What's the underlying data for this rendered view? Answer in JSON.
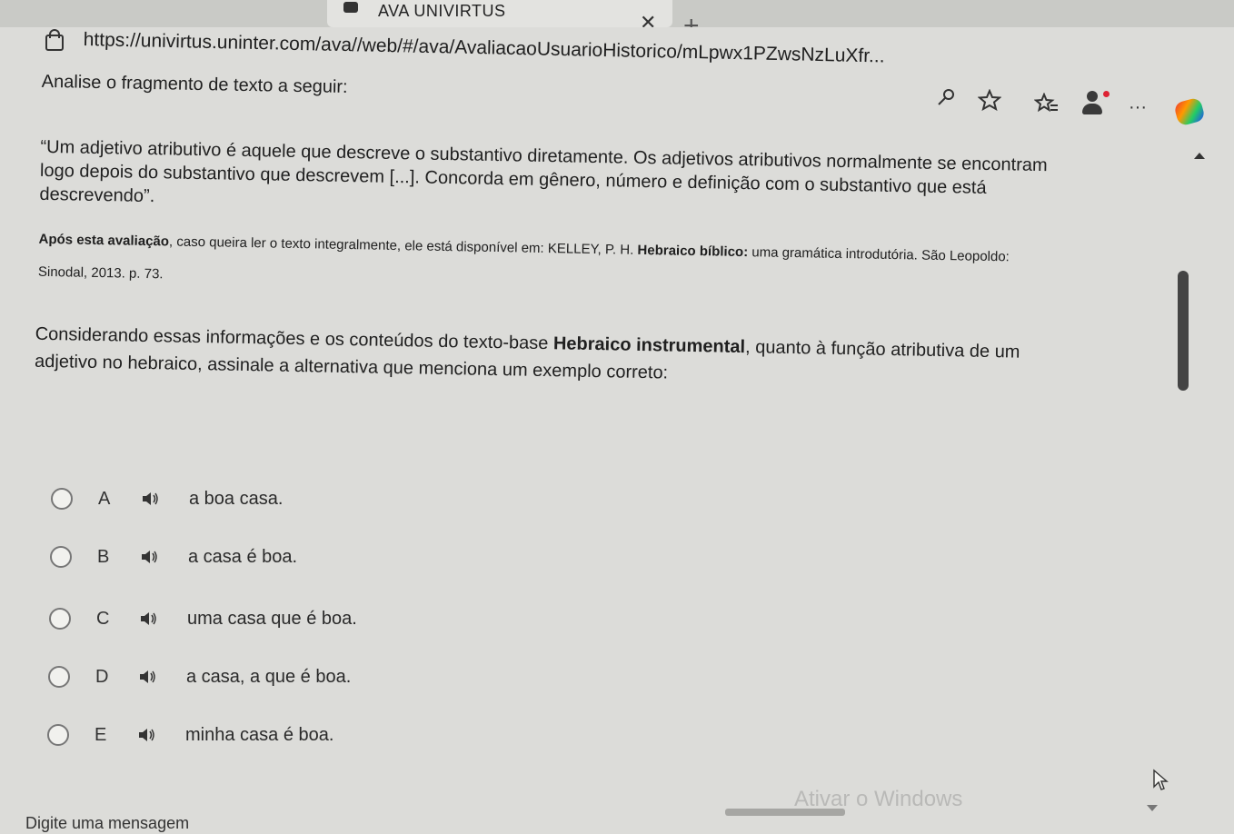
{
  "browser": {
    "tab": {
      "title": "AVA UNIVIRTUS",
      "close_icon": "close-icon",
      "favicon": "univirtus-favicon"
    },
    "new_tab_symbol": "+",
    "window_controls": {
      "minimize": "—",
      "maximize": "☐",
      "close": "✕"
    },
    "address_bar": {
      "url": "https://univirtus.uninter.com/ava//web/#/ava/AvaliacaoUsuarioHistorico/mLpwx1PZwsNzLuXfr..."
    },
    "toolbar_icons": [
      "key-icon",
      "star-icon",
      "favorites-icon",
      "profile-icon",
      "more-icon",
      "copilot-icon"
    ],
    "more_symbol": "···"
  },
  "content": {
    "intro": "Analise o fragmento de texto a seguir:",
    "quote": {
      "line1": "“Um adjetivo atributivo é aquele que descreve o substantivo diretamente. Os adjetivos atributivos normalmente se encontram",
      "line2": "logo depois do substantivo que descrevem [...]. Concorda em gênero, número e definição com o substantivo que está",
      "line3": "descrevendo”."
    },
    "source": {
      "lead_bold": "Após esta avaliação",
      "lead_rest": ", caso queira ler o texto integralmente, ele está disponível em: KELLEY, P. H. ",
      "book_bold": "Hebraico bíblico:",
      "book_rest": " uma gramática introdutória. São Leopoldo:",
      "city": "Sinodal, 2013. p. 73."
    },
    "question": {
      "part1": "Considerando essas informações e os conteúdos do texto-base ",
      "bold": "Hebraico instrumental",
      "part2": ", quanto à função atributiva de um",
      "line2": "adjetivo no hebraico, assinale a alternativa que menciona um exemplo correto:"
    },
    "options": [
      {
        "letter": "A",
        "text": "a boa casa."
      },
      {
        "letter": "B",
        "text": "a casa é boa."
      },
      {
        "letter": "C",
        "text": "uma casa que é boa."
      },
      {
        "letter": "D",
        "text": "a casa, a que é boa."
      },
      {
        "letter": "E",
        "text": "minha casa é boa."
      }
    ]
  },
  "overlay": {
    "watermark": "Ativar o Windows"
  },
  "chat": {
    "placeholder": "Digite uma mensagem"
  }
}
